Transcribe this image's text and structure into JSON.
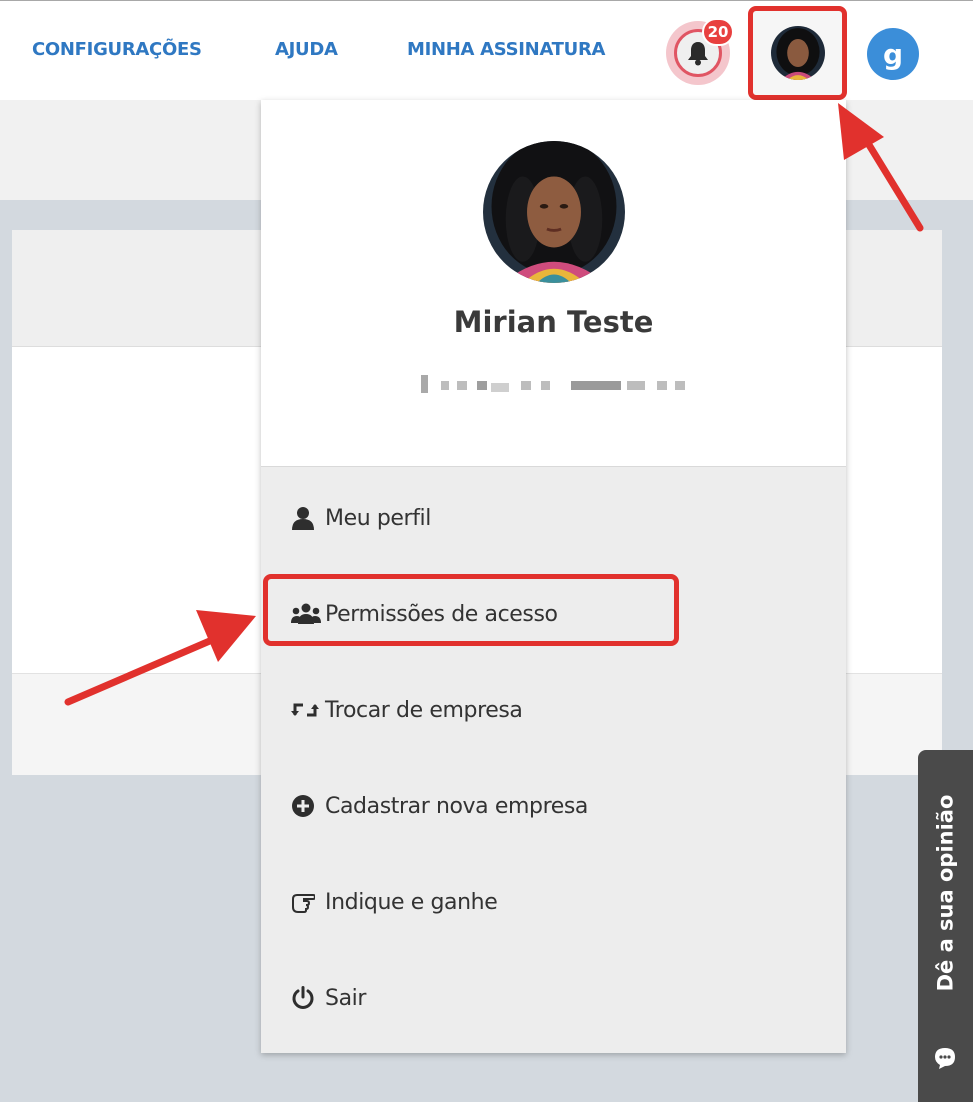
{
  "header": {
    "nav": [
      {
        "label": "CONFIGURAÇÕES"
      },
      {
        "label": "AJUDA"
      },
      {
        "label": "MINHA ASSINATURA"
      }
    ],
    "notifications": {
      "count": "20",
      "icon": "bell-icon"
    },
    "brand_logo_letter": "g",
    "accent_color": "#2f78c2"
  },
  "profile_menu": {
    "user_name": "Mirian Teste",
    "items": [
      {
        "label": "Meu perfil",
        "icon": "user-icon"
      },
      {
        "label": "Permissões de acesso",
        "icon": "users-icon"
      },
      {
        "label": "Trocar de empresa",
        "icon": "retweet-icon"
      },
      {
        "label": "Cadastrar nova empresa",
        "icon": "plus-circle-icon"
      },
      {
        "label": "Indique e ganhe",
        "icon": "hand-pointer-icon"
      },
      {
        "label": "Sair",
        "icon": "power-icon"
      }
    ]
  },
  "feedback": {
    "label": "Dê a sua opinião",
    "icon": "chat-icon"
  },
  "annotation_color": "#e1312d"
}
